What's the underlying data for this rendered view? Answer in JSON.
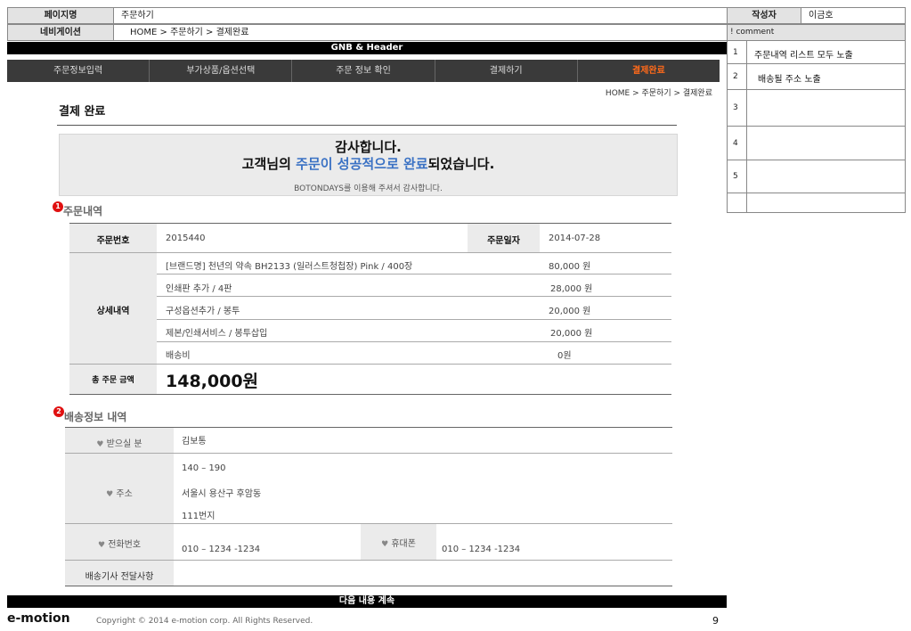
{
  "meta": {
    "page_label": "페이지명",
    "page_value": "주문하기",
    "nav_label": "네비게이션",
    "nav_value": "HOME > 주문하기 > 결제완료",
    "author_label": "작성자",
    "author_value": "이금호",
    "comment_label": "! comment"
  },
  "gnb": {
    "label": "GNB & Header"
  },
  "tabs": [
    {
      "label": "주문정보입력"
    },
    {
      "label": "부가상품/옵션선택"
    },
    {
      "label": "주문 정보 확인"
    },
    {
      "label": "결제하기"
    },
    {
      "label": "결제완료"
    }
  ],
  "breadcrumb": "HOME >  주문하기 > 결제완료",
  "page_title": "결제 완료",
  "thanks": {
    "line1": "감사합니다.",
    "line2_pre": "고객님의 ",
    "line2_highlight": "주문이 성공적으로 완료",
    "line2_post": "되었습니다.",
    "line3": "BOTONDAYS를 이용해 주셔서 감사합니다."
  },
  "order": {
    "badge": "1",
    "title": "주문내역",
    "order_no_label": "주문번호",
    "order_no_value": "2015440",
    "order_date_label": "주문일자",
    "order_date_value": "2014-07-28",
    "detail_label": "상세내역",
    "items": [
      {
        "name": "[브랜드명] 천년의 약속 BH2133 (일러스트청첩장) Pink  / 400장",
        "price": "80,000 원"
      },
      {
        "name": "인쇄판 추가  / 4판",
        "price": "28,000 원"
      },
      {
        "name": "구성옵션추가  / 봉투",
        "price": "20,000 원"
      },
      {
        "name": "제본/인쇄서비스 / 봉투삽입",
        "price": "20,000 원"
      },
      {
        "name": "배송비",
        "price": "0원"
      }
    ],
    "total_label": "총 주문 금액",
    "total_value": "148,000원"
  },
  "shipping": {
    "badge": "2",
    "title": "배송정보 내역",
    "recipient_label": "받으실 분",
    "recipient_value": "김보통",
    "address_label": "주소",
    "address_lines": [
      "140 – 190",
      "서울시 용산구 후암동",
      "111번지"
    ],
    "phone_label": "전화번호",
    "phone_value": "010 – 1234 -1234",
    "mobile_label": "휴대폰",
    "mobile_value": "010 – 1234 -1234",
    "driver_note_label": "배송기사 전달사항",
    "heart_icon": "heart-icon"
  },
  "comments": [
    {
      "num": "1",
      "text": "주문내역 리스트 모두 노출"
    },
    {
      "num": "2",
      "text": "배송될 주소 노출"
    },
    {
      "num": "3",
      "text": ""
    },
    {
      "num": "4",
      "text": ""
    },
    {
      "num": "5",
      "text": ""
    },
    {
      "num": "",
      "text": ""
    }
  ],
  "continue_label": "다음 내용 계속",
  "footer": {
    "logo": "e-motion",
    "copyright": "Copyright © 2014 e-motion corp. All Rights Reserved.",
    "page_number": "9"
  },
  "colors": {
    "active_tab": "#ff6a1a",
    "highlight": "#3b72c4",
    "badge": "#e01010"
  }
}
